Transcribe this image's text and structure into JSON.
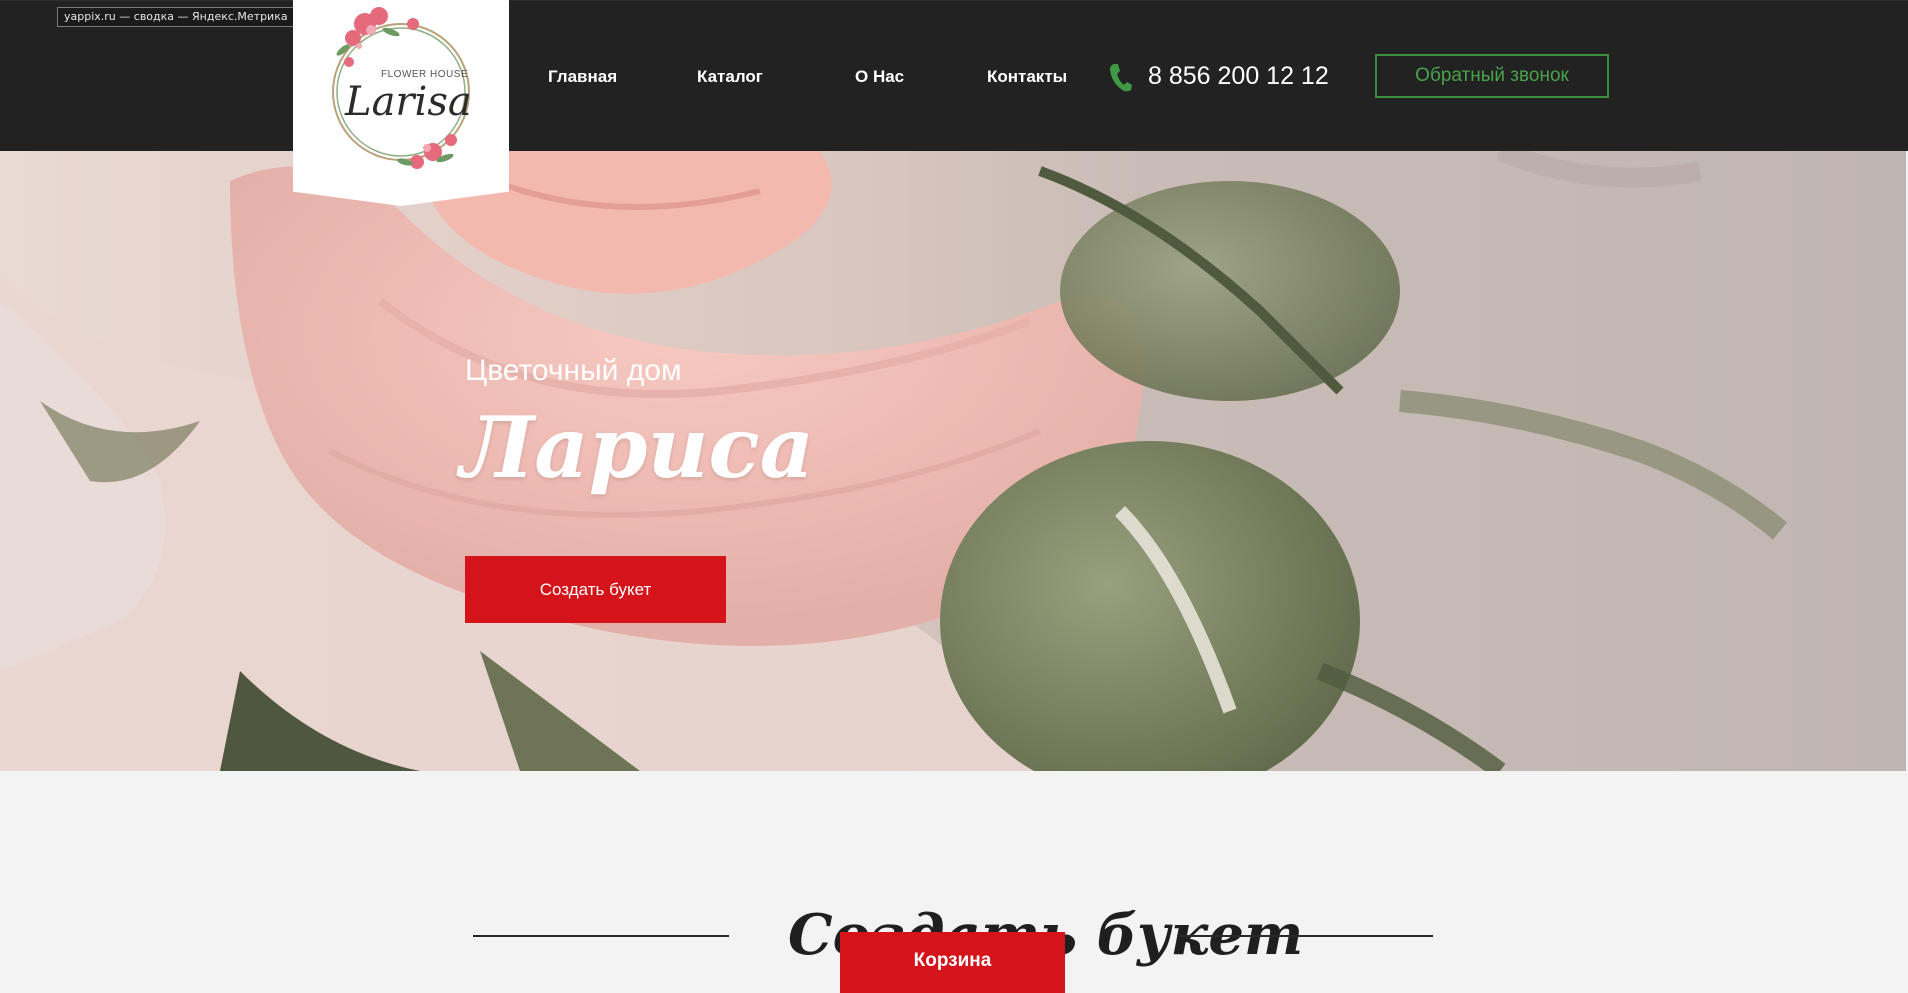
{
  "meta_badge": "yappix.ru — сводка — Яндекс.Метрика",
  "logo": {
    "script": "Larisa",
    "tagline": "FLOWER HOUSE"
  },
  "nav": {
    "items": [
      "Главная",
      "Каталог",
      "О Нас",
      "Контакты"
    ]
  },
  "phone": {
    "icon": "phone-icon",
    "number": "8 856 200 12 12"
  },
  "callback_button": "Обратный звонок",
  "hero": {
    "subtitle": "Цветочный дом",
    "title": "Лариса",
    "button": "Создать букет"
  },
  "section": {
    "title": "Создать букет"
  },
  "cart_button": "Корзина",
  "colors": {
    "header_bg": "#222222",
    "accent_red": "#d4141a",
    "accent_green": "#4aa14c",
    "page_bg": "#f3f3f3"
  }
}
